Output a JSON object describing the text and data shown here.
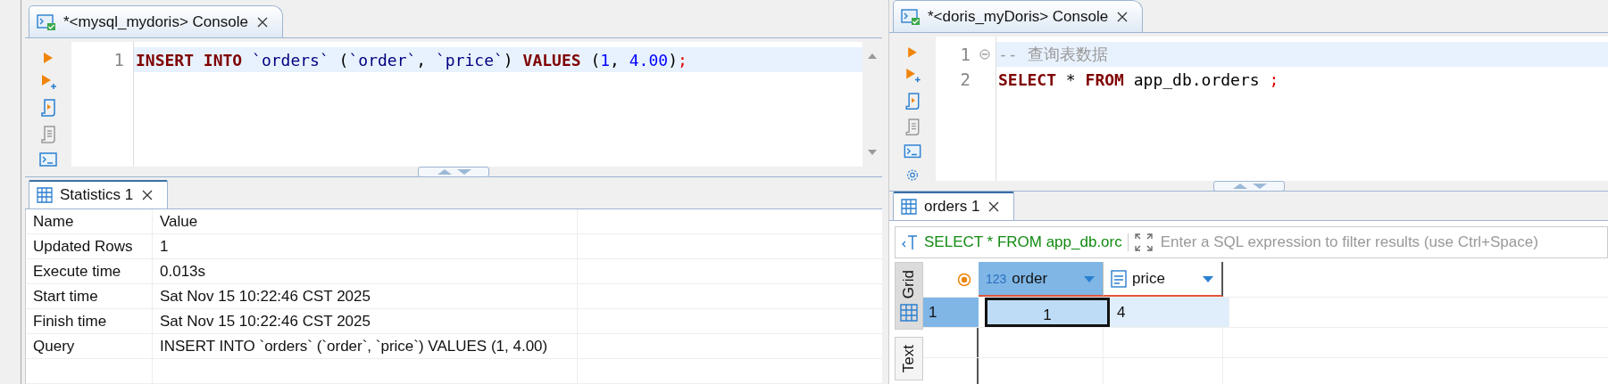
{
  "left_console": {
    "tab": {
      "title": "*<mysql_mydoris> Console"
    },
    "editor": {
      "lines": [
        {
          "number": "1",
          "foldable": false,
          "highlighted": true,
          "tokens": [
            {
              "kind": "keyword",
              "text": "INSERT INTO"
            },
            {
              "kind": "identifier",
              "text": " `orders`"
            },
            {
              "kind": "punct",
              "text": " ("
            },
            {
              "kind": "identifier",
              "text": "`order`"
            },
            {
              "kind": "punct",
              "text": ", "
            },
            {
              "kind": "identifier",
              "text": "`price`"
            },
            {
              "kind": "punct",
              "text": ")"
            },
            {
              "kind": "keyword",
              "text": " VALUES"
            },
            {
              "kind": "punct",
              "text": " ("
            },
            {
              "kind": "number",
              "text": "1"
            },
            {
              "kind": "punct",
              "text": ", "
            },
            {
              "kind": "number",
              "text": "4.00"
            },
            {
              "kind": "punct",
              "text": ")"
            },
            {
              "kind": "semicolon",
              "text": ";"
            }
          ]
        }
      ]
    }
  },
  "statistics_panel": {
    "tab": {
      "title": "Statistics 1"
    },
    "columns": [
      "Name",
      "Value"
    ],
    "rows": [
      [
        "Updated Rows",
        "1"
      ],
      [
        "Execute time",
        "0.013s"
      ],
      [
        "Start time",
        "Sat Nov 15 10:22:46 CST 2025"
      ],
      [
        "Finish time",
        "Sat Nov 15 10:22:46 CST 2025"
      ],
      [
        "Query",
        "INSERT INTO `orders` (`order`, `price`) VALUES (1, 4.00)"
      ]
    ]
  },
  "right_console": {
    "tab": {
      "title": "*<doris_myDoris> Console"
    },
    "editor": {
      "lines": [
        {
          "number": "1",
          "foldable": true,
          "highlighted": true,
          "tokens": [
            {
              "kind": "comment",
              "text": "-- 查询表数据"
            }
          ]
        },
        {
          "number": "2",
          "foldable": false,
          "highlighted": false,
          "tokens": [
            {
              "kind": "keyword",
              "text": "SELECT"
            },
            {
              "kind": "punct",
              "text": " * "
            },
            {
              "kind": "keyword",
              "text": "FROM"
            },
            {
              "kind": "plain",
              "text": " app_db.orders "
            },
            {
              "kind": "semicolon",
              "text": ";"
            }
          ]
        }
      ]
    }
  },
  "results_panel": {
    "tab": {
      "title": "orders 1"
    },
    "filter": {
      "query": "SELECT * FROM app_db.orc",
      "placeholder": "Enter a SQL expression to filter results (use Ctrl+Space)"
    },
    "view_tabs": [
      {
        "label": "Grid",
        "selected": true
      },
      {
        "label": "Text",
        "selected": false
      }
    ],
    "columns": [
      {
        "name": "order",
        "kind": "number",
        "type_label": "123",
        "selected": true
      },
      {
        "name": "price",
        "kind": "string",
        "selected": false
      }
    ],
    "rows": [
      {
        "number": "1",
        "selected": true,
        "cells": [
          {
            "value": "1",
            "focused": true
          },
          {
            "value": "4",
            "focused": false
          }
        ]
      }
    ]
  }
}
